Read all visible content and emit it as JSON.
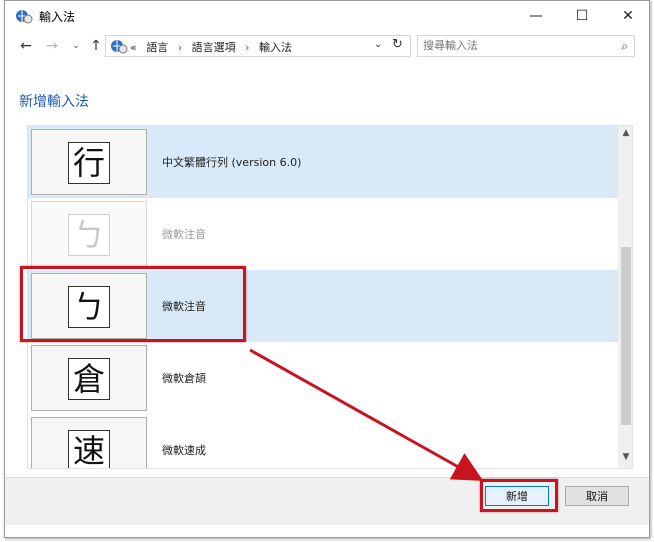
{
  "window": {
    "title": "輸入法",
    "controls": {
      "minimize": "—",
      "maximize": "☐",
      "close": "✕"
    }
  },
  "nav": {
    "back": "←",
    "forward": "→",
    "recent": "⌄",
    "up": "↑",
    "breadcrumb_prefix": "«",
    "breadcrumbs": [
      "語言",
      "語言選項",
      "輸入法"
    ],
    "separator": "›",
    "dropdown": "⌄",
    "refresh": "↻",
    "search_placeholder": "搜尋輸入法",
    "search_icon": "⌕"
  },
  "page": {
    "title": "新增輸入法"
  },
  "input_methods": [
    {
      "glyph": "行",
      "label": "中文繁體行列 (version 6.0)",
      "state": "selected-light"
    },
    {
      "glyph": "ㄅ",
      "label": "微軟注音",
      "state": "disabled"
    },
    {
      "glyph": "ㄅ",
      "label": "微軟注音",
      "state": "selected"
    },
    {
      "glyph": "倉",
      "label": "微軟倉頡",
      "state": "normal"
    },
    {
      "glyph": "速",
      "label": "微軟速成",
      "state": "normal"
    }
  ],
  "scrollbar": {
    "up": "▲",
    "down": "▼",
    "position": 0.45
  },
  "footer": {
    "add_label": "新增",
    "cancel_label": "取消"
  },
  "colors": {
    "accent": "#1e5aa8",
    "selection": "#d9e9f8",
    "annotation": "#c8141e"
  }
}
